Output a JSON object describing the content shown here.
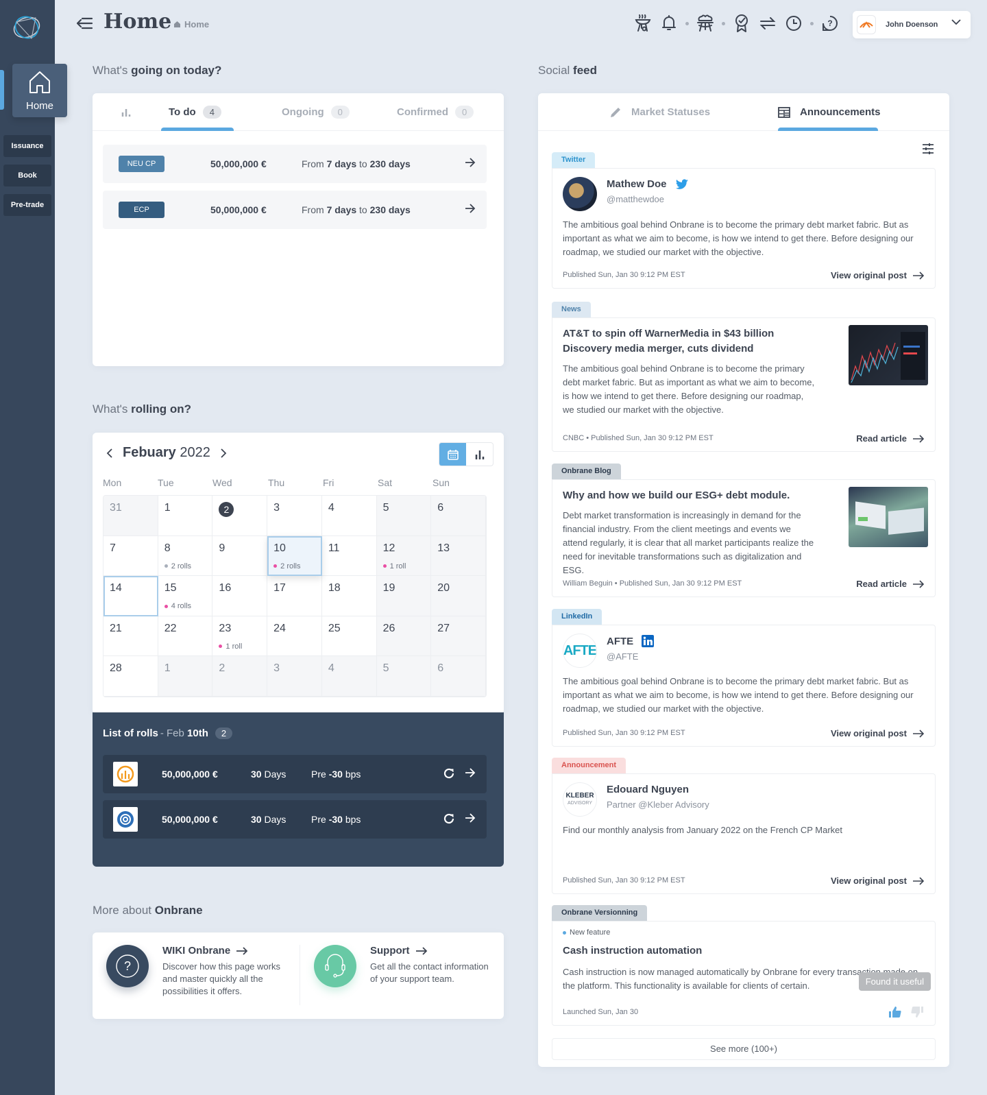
{
  "sidebar": {
    "home_label": "Home",
    "items": [
      {
        "label": "Issuance"
      },
      {
        "label": "Book"
      },
      {
        "label": "Pre-trade"
      }
    ]
  },
  "header": {
    "title": "Home",
    "breadcrumb": "Home",
    "user_name": "John Doenson"
  },
  "today": {
    "title_light": "What's",
    "title_bold": "going on today?",
    "tabs": [
      {
        "label": "To do",
        "count": "4"
      },
      {
        "label": "Ongoing",
        "count": "0"
      },
      {
        "label": "Confirmed",
        "count": "0"
      }
    ],
    "rows": [
      {
        "type": "NEU CP",
        "type_color": "#4f82aa",
        "amount": "50,000,000 €",
        "from_label": "From",
        "from": "7 days",
        "to_label": "to",
        "to": "230 days"
      },
      {
        "type": "ECP",
        "type_color": "#355d80",
        "amount": "50,000,000 €",
        "from_label": "From",
        "from": "7 days",
        "to_label": "to",
        "to": "230 days"
      }
    ]
  },
  "rolling": {
    "title_light": "What's",
    "title_bold": "rolling on?",
    "month": "Febuary",
    "year": "2022",
    "weekdays": [
      "Mon",
      "Tue",
      "Wed",
      "Thu",
      "Fri",
      "Sat",
      "Sun"
    ],
    "days": [
      {
        "d": "31",
        "kind": "out"
      },
      {
        "d": "1"
      },
      {
        "d": "2",
        "kind": "today"
      },
      {
        "d": "3"
      },
      {
        "d": "4"
      },
      {
        "d": "5",
        "kind": "wk"
      },
      {
        "d": "6",
        "kind": "wk"
      },
      {
        "d": "7"
      },
      {
        "d": "8",
        "rolls": "2 rolls",
        "dot": "grey"
      },
      {
        "d": "9"
      },
      {
        "d": "10",
        "rolls": "2 rolls",
        "kind": "sel"
      },
      {
        "d": "11"
      },
      {
        "d": "12",
        "rolls": "1 roll",
        "kind": "wk"
      },
      {
        "d": "13",
        "kind": "wk"
      },
      {
        "d": "14",
        "kind": "hov"
      },
      {
        "d": "15",
        "rolls": "4 rolls"
      },
      {
        "d": "16"
      },
      {
        "d": "17"
      },
      {
        "d": "18"
      },
      {
        "d": "19",
        "kind": "wk"
      },
      {
        "d": "20",
        "kind": "wk"
      },
      {
        "d": "21"
      },
      {
        "d": "22"
      },
      {
        "d": "23",
        "rolls": "1 roll"
      },
      {
        "d": "24"
      },
      {
        "d": "25"
      },
      {
        "d": "26",
        "kind": "wk"
      },
      {
        "d": "27",
        "kind": "wk"
      },
      {
        "d": "28"
      },
      {
        "d": "1",
        "kind": "out"
      },
      {
        "d": "2",
        "kind": "out"
      },
      {
        "d": "3",
        "kind": "out"
      },
      {
        "d": "4",
        "kind": "out"
      },
      {
        "d": "5",
        "kind": "out"
      },
      {
        "d": "6",
        "kind": "out"
      }
    ],
    "list_title": "List of rolls",
    "list_date_prefix": "- Feb",
    "list_date": "10th",
    "list_count": "2",
    "rolls": [
      {
        "logo": "orange-bars-logo",
        "amount": "50,000,000 €",
        "days_num": "30",
        "days_label": "Days",
        "pre": "Pre",
        "bps_num": "-30",
        "bps_label": "bps"
      },
      {
        "logo": "blue-a-logo",
        "amount": "50,000,000 €",
        "days_num": "30",
        "days_label": "Days",
        "pre": "Pre",
        "bps_num": "-30",
        "bps_label": "bps"
      }
    ]
  },
  "more": {
    "title_light": "More about",
    "title_bold": "Onbrane",
    "wiki_title": "WIKI Onbrane",
    "wiki_desc": "Discover how this page works and master quickly all the possibilities it offers.",
    "support_title": "Support",
    "support_desc": "Get all the contact information of your support team."
  },
  "feed": {
    "title_light": "Social",
    "title_bold": "feed",
    "tabs": [
      {
        "label": "Market Statuses"
      },
      {
        "label": "Announcements"
      }
    ],
    "posts": [
      {
        "tag": "Twitter",
        "name": "Mathew Doe",
        "handle": "@matthewdoe",
        "text": "The ambitious goal behind Onbrane is to become the primary debt market fabric. But as important as what we aim to become, is how we intend to get there. Before designing our roadmap, we studied our market with the objective.",
        "footer": "Published Sun, Jan 30 9:12 PM EST",
        "link": "View original post"
      },
      {
        "tag": "News",
        "headline": "AT&T to spin off WarnerMedia in $43 billion Discovery media merger, cuts dividend",
        "text": "The ambitious goal behind Onbrane is to become the primary debt market fabric. But as important as what we aim to become, is how we intend to get there. Before designing our roadmap, we studied our market with the objective.",
        "footer": "CNBC • Published Sun, Jan 30 9:12 PM EST",
        "link": "Read article"
      },
      {
        "tag": "Onbrane Blog",
        "headline": "Why and how we build our ESG+ debt module.",
        "text": "Debt market transformation is increasingly in demand for the financial industry. From the client meetings and events we attend regularly, it is clear that all market participants realize the need for inevitable transformations such as digitalization and ESG.",
        "footer": "William Beguin • Published Sun, Jan 30 9:12 PM EST",
        "link": "Read article"
      },
      {
        "tag": "LinkedIn",
        "name": "AFTE",
        "handle": "@AFTE",
        "avatar_text": "AFTE",
        "text": "The ambitious goal behind Onbrane is to become the primary debt market fabric. But as important as what we aim to become, is how we intend to get there. Before designing our roadmap, we studied our market with the objective.",
        "footer": "Published Sun, Jan 30 9:12 PM EST",
        "link": "View original post"
      },
      {
        "tag": "Announcement",
        "name": "Edouard Nguyen",
        "handle": "Partner @Kleber Advisory",
        "avatar_text": "KLEBER",
        "avatar_sub": "ADVISORY",
        "text": "Find our monthly analysis from January 2022 on the French CP Market",
        "footer": "Published Sun, Jan 30 9:12 PM EST",
        "link": "View original post"
      },
      {
        "tag": "Onbrane Versionning",
        "badge": "New feature",
        "headline": "Cash instruction automation",
        "text": "Cash instruction is now managed automatically by Onbrane for every transaction made on the platform. This functionality is available for clients of certain.",
        "footer": "Launched Sun, Jan 30",
        "tooltip": "Found it useful"
      }
    ],
    "see_more": "See more (100+)"
  },
  "colors": {
    "accent": "#5ba8e0",
    "sidebar": "#37475c",
    "background": "#e3e9f1",
    "roll_dot": "#e94fa4"
  }
}
